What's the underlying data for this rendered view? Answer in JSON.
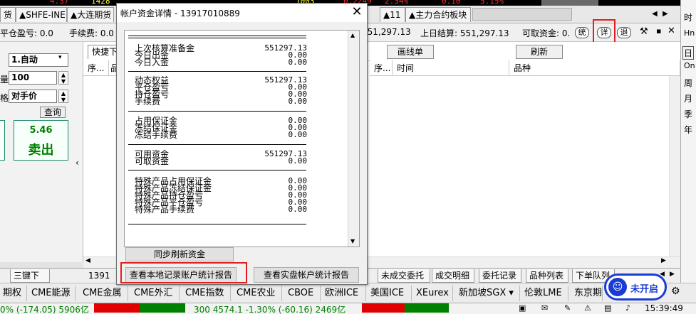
{
  "ticker": {
    "items": [
      "4.37",
      "1428",
      "1003",
      "0.2249",
      "2.34%",
      "0.10",
      "5.15%"
    ]
  },
  "tabs": [
    {
      "label": "货"
    },
    {
      "label": "▲SHFE-INE"
    },
    {
      "label": "▲大连期货"
    },
    {
      "label": "▲11"
    },
    {
      "label": "▲主力合约板块"
    }
  ],
  "infobar": {
    "floating_pl": "平仓盈亏: 0.0",
    "fee": "手续费: 0.0",
    "value1": "551,297.13",
    "prev_settle": "上日结算: 551,297.13",
    "available": "可取资金: 0.",
    "btn_sync": "统",
    "btn_detail": "详",
    "btn_exit": "退"
  },
  "right_strip": [
    "时",
    "Hn",
    "日",
    "On",
    "周",
    "月",
    "季",
    "年"
  ],
  "left_panel": {
    "mode_value": "1.自动",
    "qty_label": "量",
    "qty_value": "100",
    "price_label": "格",
    "price_value": "对手价",
    "query_btn": "查询",
    "sell_price": "5.46",
    "sell_label": "卖出"
  },
  "grid": {
    "quick_tab": "快捷下",
    "draw_btn": "画线单",
    "refresh_btn": "刷新",
    "col_seq": "序...",
    "col_pin": "品",
    "col_seq2": "序...",
    "col_time": "时间",
    "col_product": "品种"
  },
  "bottom_tabs": [
    "三键下单",
    "1391",
    "未成交委托",
    "成交明细",
    "委托记录",
    "品种列表",
    "下单队列"
  ],
  "exchange_tabs": [
    "期权",
    "CME能源",
    "CME金属",
    "CME外汇",
    "CME指数",
    "CME农业",
    "CBOE",
    "欧洲ICE",
    "美国ICE",
    "XEurex",
    "新加坡SGX ▾",
    "伦敦LME",
    "东京期"
  ],
  "status": {
    "left": "0% (-174.05) 5906亿",
    "mid": "300 4574.1 -1.30% (-60.16) 2469亿",
    "time": "15:39:49",
    "not_open": "未开启"
  },
  "dialog": {
    "title": "帐户资金详情 - 13917010889",
    "rows": [
      {
        "label": "上次核算准备金",
        "value": "551297.13"
      },
      {
        "label": "今日出金",
        "value": "0.00"
      },
      {
        "label": "今日入金",
        "value": "0.00"
      },
      {
        "label": "动态权益",
        "value": "551297.13"
      },
      {
        "label": "平仓盈亏",
        "value": "0.00"
      },
      {
        "label": "持仓盈亏",
        "value": "0.00"
      },
      {
        "label": "手续费",
        "value": "0.00"
      },
      {
        "label": "占用保证金",
        "value": "0.00"
      },
      {
        "label": "冻结保证金",
        "value": "0.00"
      },
      {
        "label": "冻结手续费",
        "value": "0.00"
      },
      {
        "label": "可用资金",
        "value": "551297.13"
      },
      {
        "label": "可取资金",
        "value": "0.00"
      },
      {
        "label": "特殊产品占用保证金",
        "value": "0.00"
      },
      {
        "label": "特殊产品冻结保证金",
        "value": "0.00"
      },
      {
        "label": "特殊产品持仓盈亏",
        "value": "0.00"
      },
      {
        "label": "特殊产品平仓盈亏",
        "value": "0.00"
      },
      {
        "label": "特殊产品手续费",
        "value": "0.00"
      }
    ],
    "btn_sync": "同步刷新资金",
    "btn_local_report": "查看本地记录账户统计报告",
    "btn_real_report": "查看实盘帐户统计报告"
  },
  "colors": {
    "up": "#e00000",
    "down": "#008000",
    "highlight": "#e02020",
    "accent_blue": "#1a3cd6"
  }
}
